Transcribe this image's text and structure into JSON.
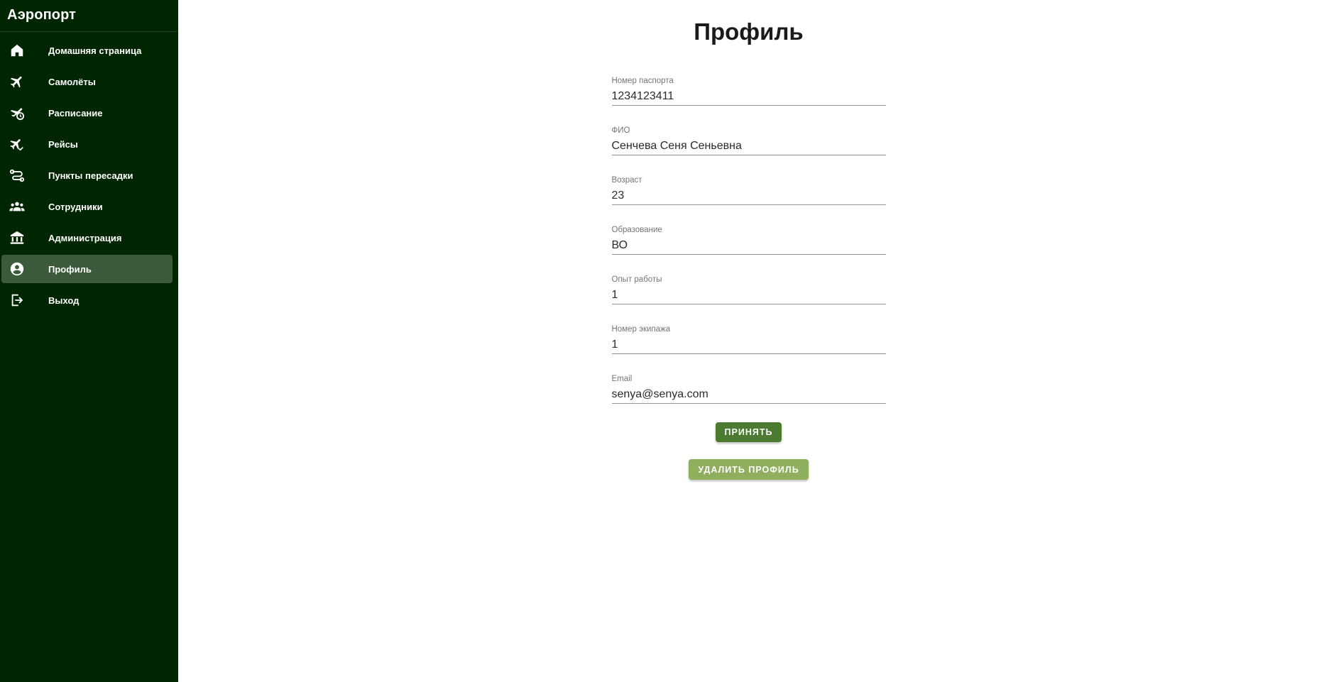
{
  "sidebar": {
    "title": "Аэропорт",
    "items": [
      {
        "label": "Домашняя страница",
        "icon": "home-icon"
      },
      {
        "label": "Самолёты",
        "icon": "airplane-icon"
      },
      {
        "label": "Расписание",
        "icon": "schedule-icon"
      },
      {
        "label": "Рейсы",
        "icon": "flight-check-icon"
      },
      {
        "label": "Пункты пересадки",
        "icon": "route-icon"
      },
      {
        "label": "Сотрудники",
        "icon": "people-icon"
      },
      {
        "label": "Администрация",
        "icon": "bank-icon"
      },
      {
        "label": "Профиль",
        "icon": "account-circle-icon",
        "active": true
      },
      {
        "label": "Выход",
        "icon": "logout-icon"
      }
    ]
  },
  "main": {
    "title": "Профиль",
    "fields": [
      {
        "label": "Номер паспорта",
        "value": "1234123411"
      },
      {
        "label": "ФИО",
        "value": "Сенчева Сеня Сеньевна"
      },
      {
        "label": "Возраст",
        "value": "23"
      },
      {
        "label": "Образование",
        "value": "ВО"
      },
      {
        "label": "Опыт работы",
        "value": "1"
      },
      {
        "label": "Номер экипажа",
        "value": "1"
      },
      {
        "label": "Email",
        "value": "senya@senya.com"
      }
    ],
    "accept_label": "Принять",
    "delete_label": "Удалить профиль"
  },
  "colors": {
    "sidebar_bg": "#002601",
    "active_item": "#3a5a3a",
    "accept_button": "#4c7a30",
    "delete_button": "#8fae5e"
  }
}
